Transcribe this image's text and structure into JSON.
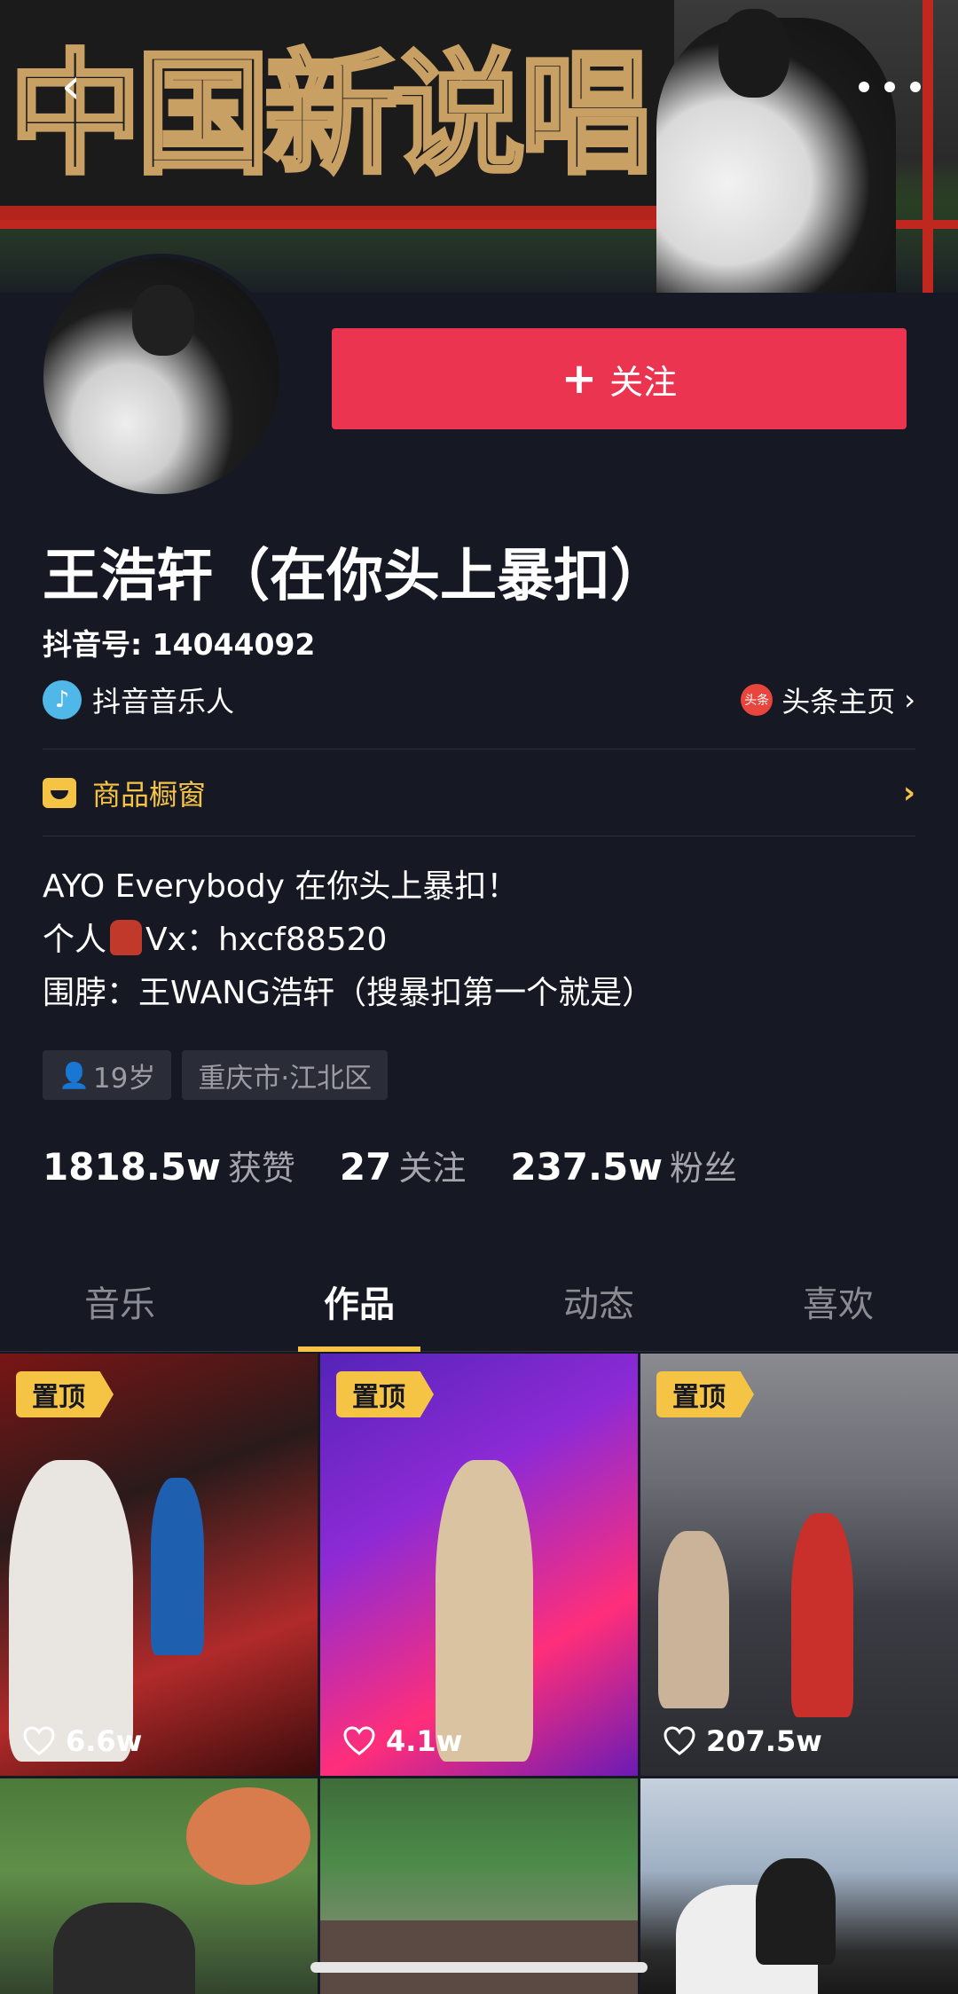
{
  "banner": {
    "sign_text": "中国新说唱"
  },
  "nav": {
    "back_icon": "chevron-left-icon",
    "more_icon": "more-dots-icon"
  },
  "profile": {
    "follow_label": "关注",
    "name": "王浩轩（在你头上暴扣）",
    "douyin_id": "抖音号: 14044092",
    "badge_label": "抖音音乐人",
    "toutiao_label": "头条主页",
    "toutiao_icon_text": "头条",
    "shop_label": "商品橱窗",
    "bio": {
      "line1": "AYO Everybody 在你头上暴扣！",
      "line2_prefix": "个人",
      "line2_suffix": "Vx：hxcf88520",
      "line3": "围脖：王WANG浩轩（搜暴扣第一个就是）"
    },
    "age": "19岁",
    "location": "重庆市·江北区",
    "stats": {
      "likes_num": "1818.5w",
      "likes_label": "获赞",
      "following_num": "27",
      "following_label": "关注",
      "fans_num": "237.5w",
      "fans_label": "粉丝"
    }
  },
  "tabs": [
    {
      "label": "音乐"
    },
    {
      "label": "作品"
    },
    {
      "label": "动态"
    },
    {
      "label": "喜欢"
    }
  ],
  "active_tab": "作品",
  "videos": [
    {
      "pinned": "置顶",
      "likes": "6.6w"
    },
    {
      "pinned": "置顶",
      "likes": "4.1w"
    },
    {
      "pinned": "置顶",
      "likes": "207.5w"
    },
    {
      "pinned": "",
      "likes": ""
    },
    {
      "pinned": "",
      "likes": ""
    },
    {
      "pinned": "",
      "likes": ""
    }
  ],
  "colors": {
    "background": "#161823",
    "follow_button": "#ea3450",
    "accent_yellow": "#f5c445",
    "muted_text": "#a3a4ac"
  }
}
